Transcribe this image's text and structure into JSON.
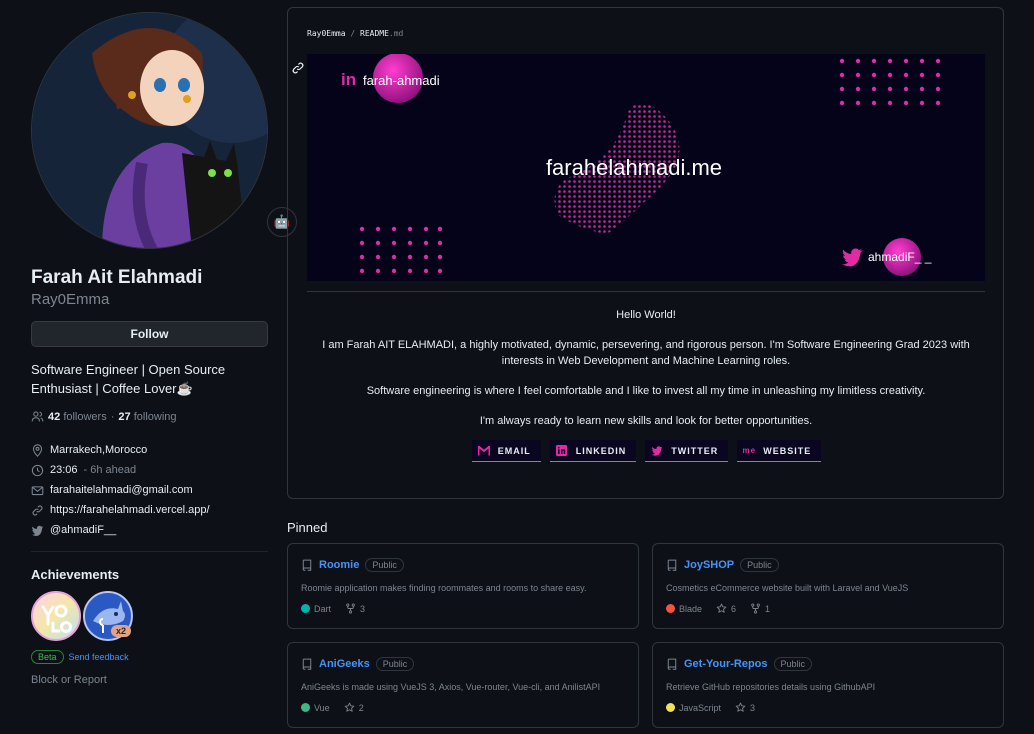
{
  "profile": {
    "full_name": "Farah Ait Elahmadi",
    "username": "Ray0Emma",
    "follow_label": "Follow",
    "bio": "Software Engineer | Open Source Enthusiast | Coffee Lover",
    "bio_emoji": "☕",
    "status_emoji": "🤖",
    "followers_count": "42",
    "followers_label": "followers",
    "separator": "·",
    "following_count": "27",
    "following_label": "following",
    "location": "Marrakech,Morocco",
    "time": "23:06",
    "time_offset": "- 6h ahead",
    "email": "farahaitelahmadi@gmail.com",
    "website": "https://farahelahmadi.vercel.app/",
    "twitter": "@ahmadiF__"
  },
  "achievements": {
    "title": "Achievements",
    "badges": [
      "yolo",
      "pull-shark"
    ],
    "multiplier": "x2",
    "beta_label": "Beta",
    "feedback_link": "Send feedback"
  },
  "block_report": "Block or Report",
  "readme": {
    "breadcrumb_user": "Ray0Emma",
    "breadcrumb_sep": "/",
    "breadcrumb_file": "README",
    "breadcrumb_ext": ".md",
    "banner": {
      "linkedin_handle": "farah-ahmadi",
      "site": "farahelahmadi.me",
      "twitter_handle": "ahmadiF_ _"
    },
    "paragraphs": [
      "Hello World!",
      "I am Farah AIT ELAHMADI, a highly motivated, dynamic, persevering, and rigorous person. I'm Software Engineering Grad 2023 with interests in Web Development and Machine Learning roles.",
      "Software engineering is where I feel comfortable and I like to invest all my time in unleashing my limitless creativity.",
      "I'm always ready to learn new skills and look for better opportunities."
    ],
    "social_buttons": [
      {
        "label": "EMAIL",
        "icon": "M"
      },
      {
        "label": "LINKEDIN",
        "icon": "in"
      },
      {
        "label": "TWITTER",
        "icon": "twitter"
      },
      {
        "label": "WEBSITE",
        "icon": "me"
      }
    ]
  },
  "pinned": {
    "title": "Pinned",
    "repos": [
      {
        "name": "Roomie",
        "visibility": "Public",
        "description": "Roomie application makes finding roommates and rooms to share easy.",
        "language": "Dart",
        "lang_color": "#00B4AB",
        "stat_type": "forks",
        "stat": "3"
      },
      {
        "name": "JoySHOP",
        "visibility": "Public",
        "description": "Cosmetics eCommerce website built with Laravel and VueJS",
        "language": "Blade",
        "lang_color": "#f7523f",
        "stars": "6",
        "forks": "1"
      },
      {
        "name": "AniGeeks",
        "visibility": "Public",
        "description": "AniGeeks is made using VueJS 3, Axios, Vue-router, Vue-cli, and AnilistAPI",
        "language": "Vue",
        "lang_color": "#41b883",
        "stat_type": "stars",
        "stat": "2"
      },
      {
        "name": "Get-Your-Repos",
        "visibility": "Public",
        "description": "Retrieve GitHub repositories details using GithubAPI",
        "language": "JavaScript",
        "lang_color": "#f1e05a",
        "stat_type": "stars",
        "stat": "3"
      }
    ]
  },
  "colors": {
    "accent": "#4493f8",
    "magenta": "#e12ba4",
    "background": "#0d1117",
    "border": "#30363d"
  }
}
